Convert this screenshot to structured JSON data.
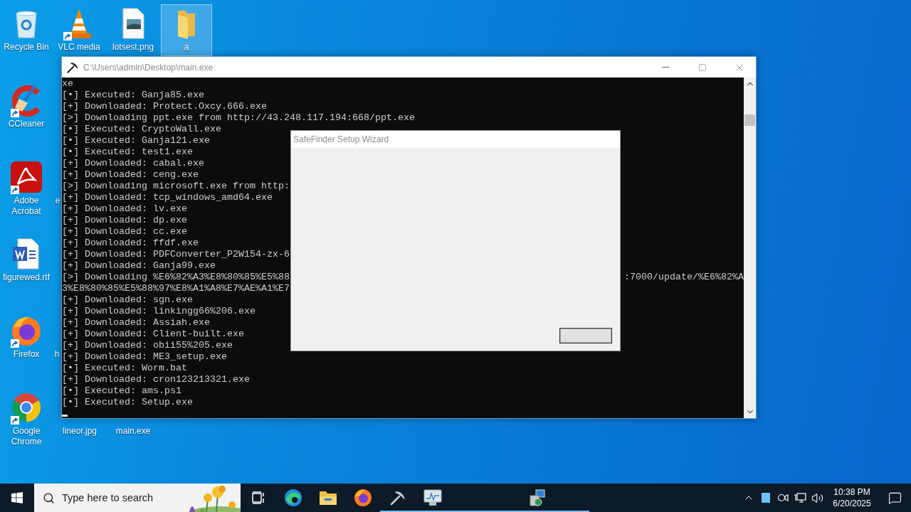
{
  "desktop_icons": [
    {
      "label": "Recycle Bin",
      "kind": "recycle-bin",
      "shortcut": false,
      "selected": false
    },
    {
      "label": "VLC media",
      "kind": "vlc",
      "shortcut": true,
      "selected": false
    },
    {
      "label": "lotsest.png",
      "kind": "image-file",
      "shortcut": false,
      "selected": false
    },
    {
      "label": "a",
      "kind": "folder",
      "shortcut": false,
      "selected": true
    },
    {
      "label": "CCleaner",
      "kind": "ccleaner",
      "shortcut": true,
      "selected": false
    },
    {
      "label": "Adobe Acrobat",
      "kind": "acrobat",
      "shortcut": true,
      "selected": false
    },
    {
      "label": "figurewed.rtf",
      "kind": "word-doc",
      "shortcut": false,
      "selected": false
    },
    {
      "label": "Firefox",
      "kind": "firefox",
      "shortcut": true,
      "selected": false
    },
    {
      "label": "Google Chrome",
      "kind": "chrome",
      "shortcut": true,
      "selected": false
    },
    {
      "label": "lineor.jpg",
      "kind": "hidden",
      "selected": false
    },
    {
      "label": "main.exe",
      "kind": "hidden",
      "selected": false
    },
    {
      "label": "e",
      "kind": "hidden",
      "selected": false
    },
    {
      "label": "h",
      "kind": "hidden",
      "selected": false
    }
  ],
  "console_window": {
    "title": "C:\\Users\\admin\\Desktop\\main.exe",
    "lines": [
      {
        "text": "xe"
      },
      {
        "text": "[•] Executed: Ganja85.exe"
      },
      {
        "text": "[+] Downloaded: Protect.Oxcy.666.exe"
      },
      {
        "text": "[>] Downloading ppt.exe from http://43.248.117.194:668/ppt.exe"
      },
      {
        "text": "[•] Executed: CryptoWall.exe"
      },
      {
        "text": "[•] Executed: Ganja121.exe"
      },
      {
        "text": "[•] Executed: test1.exe"
      },
      {
        "text": "[+] Downloaded: cabal.exe"
      },
      {
        "text": "[+] Downloaded: ceng.exe"
      },
      {
        "text": "[>] Downloading microsoft.exe from http:"
      },
      {
        "text": "[+] Downloaded: tcp_windows_amd64.exe"
      },
      {
        "text": "[+] Downloaded: lv.exe"
      },
      {
        "text": "[+] Downloaded: dp.exe"
      },
      {
        "text": "[+] Downloaded: cc.exe"
      },
      {
        "text": "[+] Downloaded: ffdf.exe"
      },
      {
        "text": "[+] Downloaded: PDFConverter_P2W154-zx-6"
      },
      {
        "text": "[+] Downloaded: Ganja99.exe"
      },
      {
        "text": "[>] Downloading %E6%82%A3%E8%80%85%E5%88",
        "right": ":7000/update/%E6%82%A"
      },
      {
        "text": "3%E8%80%85%E5%88%97%E8%A1%A8%E7%AE%A1%E7"
      },
      {
        "text": "[+] Downloaded: sgn.exe"
      },
      {
        "text": "[+] Downloaded: linkingg66%206.exe"
      },
      {
        "text": "[+] Downloaded: Assiah.exe"
      },
      {
        "text": "[+] Downloaded: Client-built.exe"
      },
      {
        "text": "[+] Downloaded: obii55%205.exe"
      },
      {
        "text": "[+] Downloaded: ME3_setup.exe"
      },
      {
        "text": "[•] Executed: Worm.bat"
      },
      {
        "text": "[+] Downloaded: cron123213321.exe"
      },
      {
        "text": "[•] Executed: ams.ps1"
      },
      {
        "text": "[•] Executed: Setup.exe"
      }
    ]
  },
  "dialog": {
    "title": "SafeFinder Setup Wizard"
  },
  "taskbar": {
    "search": {
      "placeholder": "Type here to search"
    },
    "apps": [
      {
        "kind": "task-view",
        "running": false
      },
      {
        "kind": "edge",
        "running": false
      },
      {
        "kind": "explorer",
        "running": false
      },
      {
        "kind": "firefox",
        "running": false
      },
      {
        "kind": "pickaxe",
        "running": true
      },
      {
        "kind": "monitor",
        "running": true
      },
      {
        "kind": "blank",
        "running": true
      },
      {
        "kind": "blank",
        "running": true
      },
      {
        "kind": "installer",
        "running": true
      },
      {
        "kind": "blank",
        "running": true
      }
    ],
    "clock": {
      "time": "10:38 PM",
      "date": "6/20/2025"
    }
  }
}
